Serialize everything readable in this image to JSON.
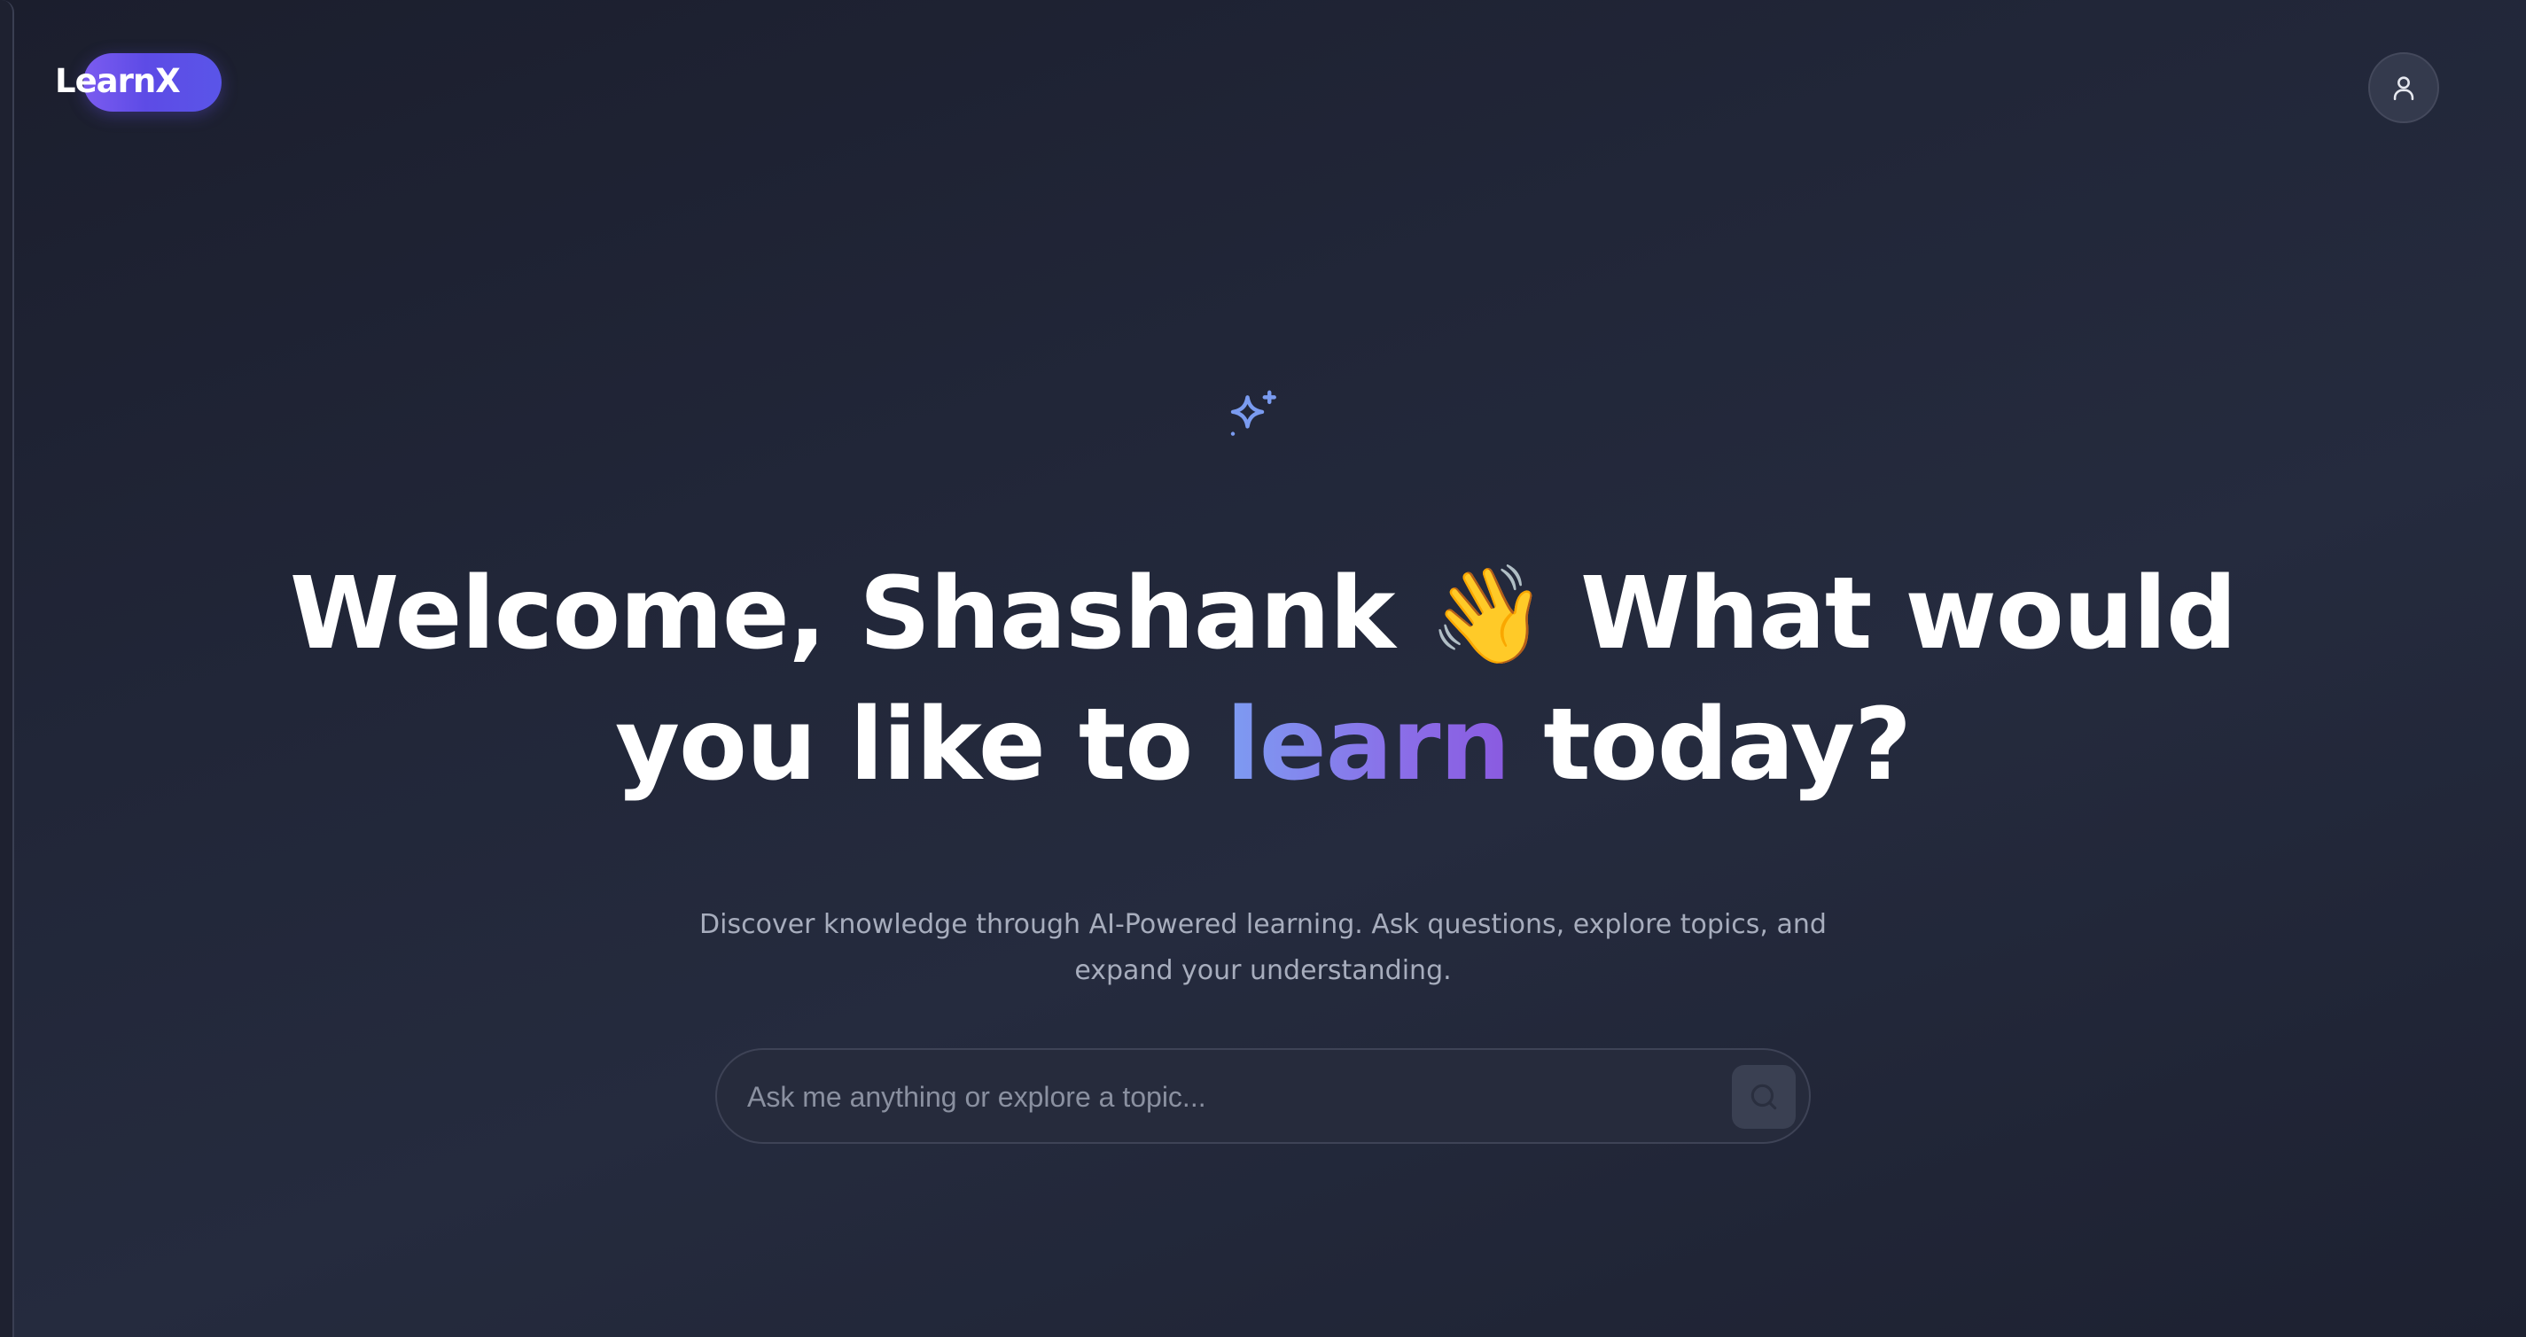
{
  "brand": {
    "logo_text": "LearnX",
    "accent_color": "#6b5cf0"
  },
  "header": {
    "profile_icon": "user-icon"
  },
  "hero": {
    "sparkle_icon": "sparkles-icon",
    "headline_part1": "Welcome, Shashank",
    "wave_emoji": "👋",
    "headline_part2": "What would you like to",
    "headline_accent": "learn",
    "headline_part3": "today?",
    "subtitle": "Discover knowledge through AI-Powered learning. Ask questions, explore topics, and expand your understanding."
  },
  "search": {
    "placeholder": "Ask me anything or explore a topic...",
    "value": "",
    "button_icon": "search-icon"
  }
}
